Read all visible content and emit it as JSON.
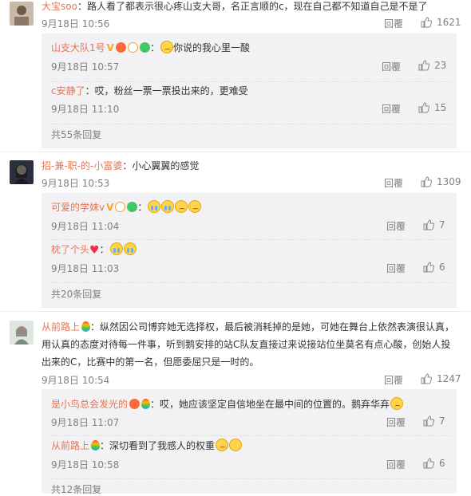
{
  "comments": [
    {
      "user": "大宝soo",
      "text": "：路人看了都表示很心疼山支大哥，名正言顺的c，现在自己都不知道自己是不是了",
      "time": "9月18日 10:56",
      "reply_label": "回覆",
      "likes": "1621",
      "replies": [
        {
          "user": "山支大队1号",
          "text": "你说的我心里一酸",
          "time": "9月18日 10:57",
          "reply_label": "回覆",
          "likes": "23"
        },
        {
          "user": "c安静了",
          "text": "：哎，粉丝一票一票投出来的，更难受",
          "time": "9月18日 11:10",
          "reply_label": "回覆",
          "likes": "15"
        }
      ],
      "more": "共55条回复"
    },
    {
      "user": "招-兼-职-的-小富婆",
      "text": "：小心翼翼的感觉",
      "time": "9月18日 10:53",
      "reply_label": "回覆",
      "likes": "1309",
      "replies": [
        {
          "user": "可爱的学妹v",
          "text": "",
          "time": "9月18日 11:04",
          "reply_label": "回覆",
          "likes": "7"
        },
        {
          "user": "枕了个头",
          "text": "",
          "time": "9月18日 11:03",
          "reply_label": "回覆",
          "likes": "6"
        }
      ],
      "more": "共20条回复"
    },
    {
      "user": "从前路上",
      "text_lines": [
        "：纵然因公司博弈她无选择权，最后被消耗掉的是她，可她在舞台上依然表演很认真，",
        "用认真的态度对待每一件事，听到鹅安排的站C队友直接过来说接站位坐莫名有点心酸，创始人投",
        "出来的C，比赛中的第一名，但愿委屈只是一时的。"
      ],
      "time": "9月18日 10:54",
      "reply_label": "回覆",
      "likes": "1247",
      "replies": [
        {
          "user": "是小鸟总会发光的",
          "text": "：哎，她应该坚定自信地坐在最中间的位置的。鹅弃华弃",
          "time": "9月18日 11:07",
          "reply_label": "回覆",
          "likes": "7"
        },
        {
          "user": "从前路上",
          "text": "：深切看到了我感人的权重",
          "time": "9月18日 10:58",
          "reply_label": "回覆",
          "likes": "6"
        }
      ],
      "more": "共12条回复"
    }
  ],
  "colors": {
    "name": "#eb7350",
    "meta": "#808080",
    "reply_bg": "#f2f2f5"
  }
}
